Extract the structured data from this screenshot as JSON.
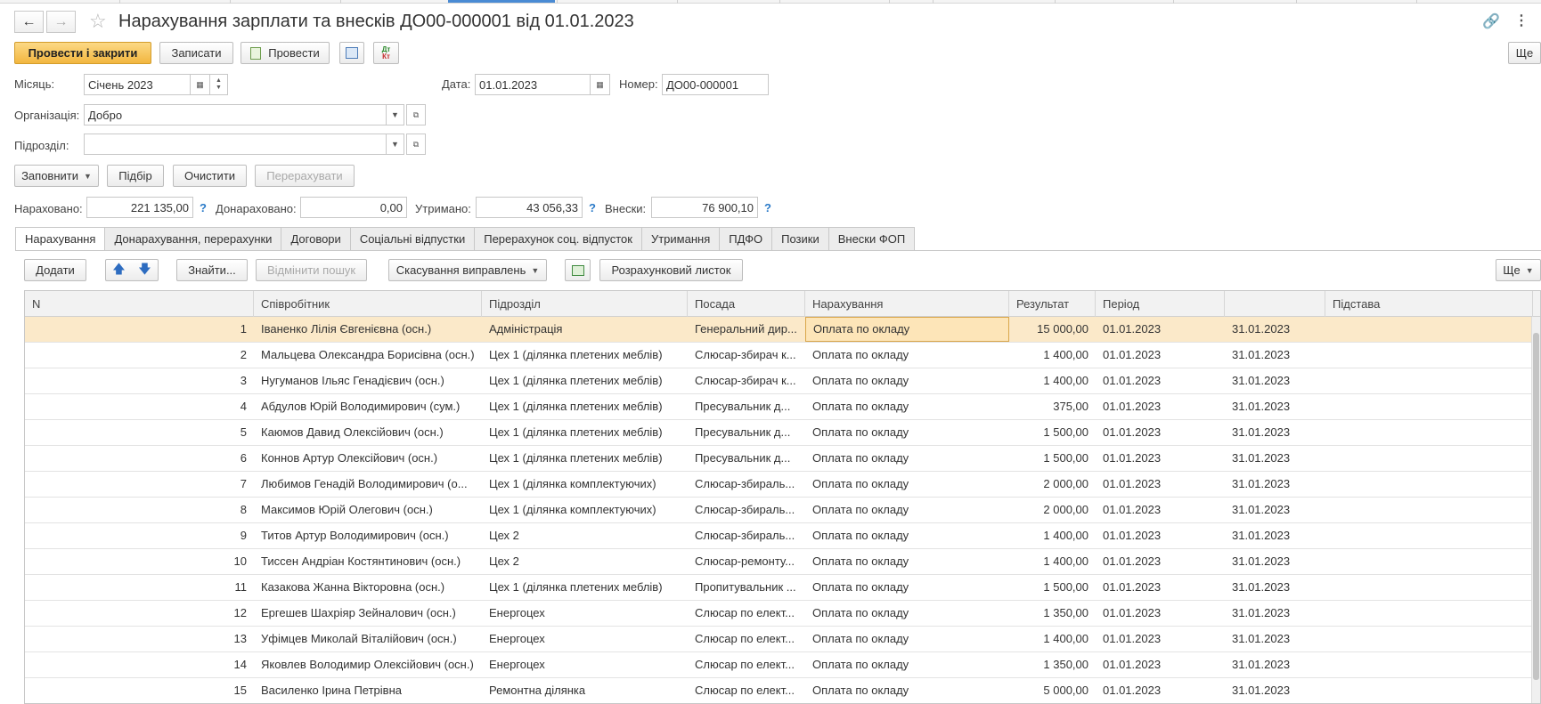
{
  "window": {
    "title": "Нарахування зарплати та внесків ДО00-000001 від 01.01.2023",
    "more_label": "Ще"
  },
  "toolbar": {
    "post_close": "Провести і закрити",
    "save": "Записати",
    "post": "Провести"
  },
  "header": {
    "month_label": "Місяць:",
    "month_value": "Січень 2023",
    "date_label": "Дата:",
    "date_value": "01.01.2023",
    "number_label": "Номер:",
    "number_value": "ДО00-000001",
    "org_label": "Організація:",
    "org_value": "Добро",
    "dept_label": "Підрозділ:",
    "dept_value": ""
  },
  "actions": {
    "fill": "Заповнити",
    "pick": "Підбір",
    "clear": "Очистити",
    "recalc": "Перерахувати"
  },
  "totals": {
    "accrued_label": "Нараховано:",
    "accrued_value": "221 135,00",
    "extra_label": "Донараховано:",
    "extra_value": "0,00",
    "withheld_label": "Утримано:",
    "withheld_value": "43 056,33",
    "contrib_label": "Внески:",
    "contrib_value": "76 900,10",
    "help": "?"
  },
  "tabs": [
    "Нарахування",
    "Донарахування, перерахунки",
    "Договори",
    "Соціальні відпустки",
    "Перерахунок соц. відпусток",
    "Утримання",
    "ПДФО",
    "Позики",
    "Внески ФОП"
  ],
  "grid_toolbar": {
    "add": "Додати",
    "find": "Знайти...",
    "cancel_search": "Відмінити пошук",
    "cancel_corrections": "Скасування виправлень",
    "payslip": "Розрахунковий листок",
    "more": "Ще"
  },
  "columns": [
    "N",
    "Співробітник",
    "Підрозділ",
    "Посада",
    "Нарахування",
    "Результат",
    "Період",
    "",
    "Підстава"
  ],
  "rows": [
    [
      "1",
      "Іваненко Лілія Євгенієвна (осн.)",
      "Адміністрація",
      "Генеральний дир...",
      "Оплата по окладу",
      "15 000,00",
      "01.01.2023",
      "31.01.2023",
      ""
    ],
    [
      "2",
      "Мальцева Олександра Борисівна (осн.)",
      "Цех 1 (ділянка плетених меблів)",
      "Слюсар-збирач к...",
      "Оплата по окладу",
      "1 400,00",
      "01.01.2023",
      "31.01.2023",
      ""
    ],
    [
      "3",
      "Нугуманов Ільяс Генадієвич (осн.)",
      "Цех 1 (ділянка плетених меблів)",
      "Слюсар-збирач к...",
      "Оплата по окладу",
      "1 400,00",
      "01.01.2023",
      "31.01.2023",
      ""
    ],
    [
      "4",
      "Абдулов Юрій Володимирович (сум.)",
      "Цех 1 (ділянка плетених меблів)",
      "Пресувальник д...",
      "Оплата по окладу",
      "375,00",
      "01.01.2023",
      "31.01.2023",
      ""
    ],
    [
      "5",
      "Каюмов Давид Олексійович (осн.)",
      "Цех 1 (ділянка плетених меблів)",
      "Пресувальник д...",
      "Оплата по окладу",
      "1 500,00",
      "01.01.2023",
      "31.01.2023",
      ""
    ],
    [
      "6",
      "Коннов Артур Олексійович (осн.)",
      "Цех 1 (ділянка плетених меблів)",
      "Пресувальник д...",
      "Оплата по окладу",
      "1 500,00",
      "01.01.2023",
      "31.01.2023",
      ""
    ],
    [
      "7",
      "Любимов Генадій Володимирович (о...",
      "Цех 1 (ділянка комплектуючих)",
      "Слюсар-збираль...",
      "Оплата по окладу",
      "2 000,00",
      "01.01.2023",
      "31.01.2023",
      ""
    ],
    [
      "8",
      "Максимов Юрій Олегович (осн.)",
      "Цех 1 (ділянка комплектуючих)",
      "Слюсар-збираль...",
      "Оплата по окладу",
      "2 000,00",
      "01.01.2023",
      "31.01.2023",
      ""
    ],
    [
      "9",
      "Титов Артур Володимирович (осн.)",
      "Цех 2",
      "Слюсар-збираль...",
      "Оплата по окладу",
      "1 400,00",
      "01.01.2023",
      "31.01.2023",
      ""
    ],
    [
      "10",
      "Тиссен Андріан Костянтинович (осн.)",
      "Цех 2",
      "Слюсар-ремонту...",
      "Оплата по окладу",
      "1 400,00",
      "01.01.2023",
      "31.01.2023",
      ""
    ],
    [
      "11",
      "Казакова Жанна Вікторовна (осн.)",
      "Цех 1 (ділянка плетених меблів)",
      "Пропитувальник ...",
      "Оплата по окладу",
      "1 500,00",
      "01.01.2023",
      "31.01.2023",
      ""
    ],
    [
      "12",
      "Ергешев Шахріяр Зейналович (осн.)",
      "Енергоцех",
      "Слюсар по елект...",
      "Оплата по окладу",
      "1 350,00",
      "01.01.2023",
      "31.01.2023",
      ""
    ],
    [
      "13",
      "Уфімцев Миколай Віталійович (осн.)",
      "Енергоцех",
      "Слюсар по елект...",
      "Оплата по окладу",
      "1 400,00",
      "01.01.2023",
      "31.01.2023",
      ""
    ],
    [
      "14",
      "Яковлев Володимир Олексійович (осн.)",
      "Енергоцех",
      "Слюсар по елект...",
      "Оплата по окладу",
      "1 350,00",
      "01.01.2023",
      "31.01.2023",
      ""
    ],
    [
      "15",
      "Василенко Ірина Петрівна",
      "Ремонтна ділянка",
      "Слюсар по елект...",
      "Оплата по окладу",
      "5 000,00",
      "01.01.2023",
      "31.01.2023",
      ""
    ]
  ],
  "colors": {
    "primary_button": "#f2b63f",
    "selected_row": "#fbe9c9",
    "help_mark": "#2a7ac8"
  },
  "icons": [
    "back-arrow-icon",
    "forward-arrow-icon",
    "star-icon",
    "link-icon",
    "kebab-menu-icon",
    "calendar-icon",
    "structure-icon",
    "dt-kt-icon",
    "move-up-icon",
    "move-down-icon",
    "excel-add-icon"
  ]
}
